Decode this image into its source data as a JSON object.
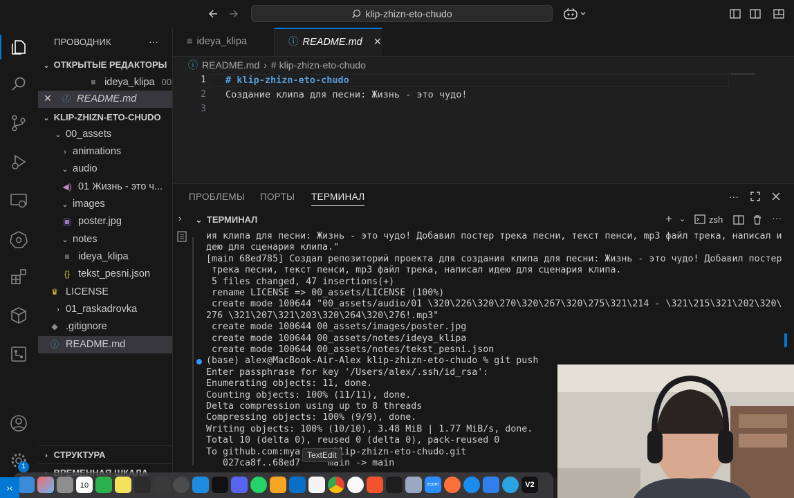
{
  "titlebar": {
    "search_text": "klip-zhizn-eto-chudo"
  },
  "activity_bar": {
    "account_badge": "1"
  },
  "explorer": {
    "title": "ПРОВОДНИК",
    "open_editors_label": "ОТКРЫТЫЕ РЕДАКТОРЫ",
    "open_editors": [
      {
        "name": "ideya_klipa",
        "path": "00..."
      },
      {
        "name": "README.md"
      }
    ],
    "project_label": "KLIP-ZHIZN-ETO-CHUDO",
    "tree": {
      "assets": "00_assets",
      "animations": "animations",
      "audio": "audio",
      "audio_file": "01 Жизнь - это ч...",
      "images": "images",
      "poster": "poster.jpg",
      "notes": "notes",
      "ideya": "ideya_klipa",
      "tekst": "tekst_pesni.json",
      "license": "LICENSE",
      "raskadrovka": "01_raskadrovka",
      "gitignore": ".gitignore",
      "readme": "README.md"
    },
    "structure_label": "СТРУКТУРА",
    "timeline_label": "ВРЕМЕННАЯ ШКАЛА"
  },
  "tabs": [
    {
      "label": "ideya_klipa"
    },
    {
      "label": "README.md"
    }
  ],
  "breadcrumb": {
    "file": "README.md",
    "section": "# klip-zhizn-eto-chudo"
  },
  "editor": {
    "lines": [
      {
        "num": "1",
        "text": "# klip-zhizn-eto-chudo"
      },
      {
        "num": "2",
        "text": "Создание клипа для песни: Жизнь - это чудо!"
      },
      {
        "num": "3",
        "text": ""
      }
    ]
  },
  "panel": {
    "tabs": [
      "ПРОБЛЕМЫ",
      "ПОРТЫ",
      "ТЕРМИНАЛ"
    ],
    "terminal_title": "ТЕРМИНАЛ",
    "shell": "zsh",
    "lines": [
      "ия клипа для песни: Жизнь - это чудо! Добавил постер трека песни, текст пенси, mp3 файл трека, написал и",
      "дею для сценария клипа.\"",
      "[main 68ed785] Создал репозиторий проекта для создания клипа для песни: Жизнь - это чудо! Добавил постер",
      " трека песни, текст пенси, mp3 файл трека, написал идею для сценария клипа.",
      " 5 files changed, 47 insertions(+)",
      " rename LICENSE => 00_assets/LICENSE (100%)",
      " create mode 100644 \"00_assets/audio/01 \\320\\226\\320\\270\\320\\267\\320\\275\\321\\214 - \\321\\215\\321\\202\\320\\",
      "276 \\321\\207\\321\\203\\320\\264\\320\\276!.mp3\"",
      " create mode 100644 00_assets/images/poster.jpg",
      " create mode 100644 00_assets/notes/ideya_klipa",
      " create mode 100644 00_assets/notes/tekst_pesni.json",
      "(base) alex@MacBook-Air-Alex klip-zhizn-eto-chudo % git push",
      "Enter passphrase for key '/Users/alex/.ssh/id_rsa':",
      "Enumerating objects: 11, done.",
      "Counting objects: 100% (11/11), done.",
      "Delta compression using up to 8 threads",
      "Compressing objects: 100% (9/9), done.",
      "Writing objects: 100% (10/10), 3.48 MiB | 1.77 MiB/s, done.",
      "Total 10 (delta 0), reused 0 (delta 0), pack-reused 0",
      "To github.com:mya      klip-zhizn-eto-chudo.git",
      "   027ca8f..68ed7     main -> main"
    ]
  },
  "tooltip": "TextEdit",
  "dock": {
    "calendar_day": "10",
    "v2_label": "V2",
    "zoom_label": "zoom"
  },
  "colors": {
    "accent": "#0078d4",
    "background": "#1f1f1f",
    "sidebar": "#181818",
    "heading": "#569cd6"
  }
}
